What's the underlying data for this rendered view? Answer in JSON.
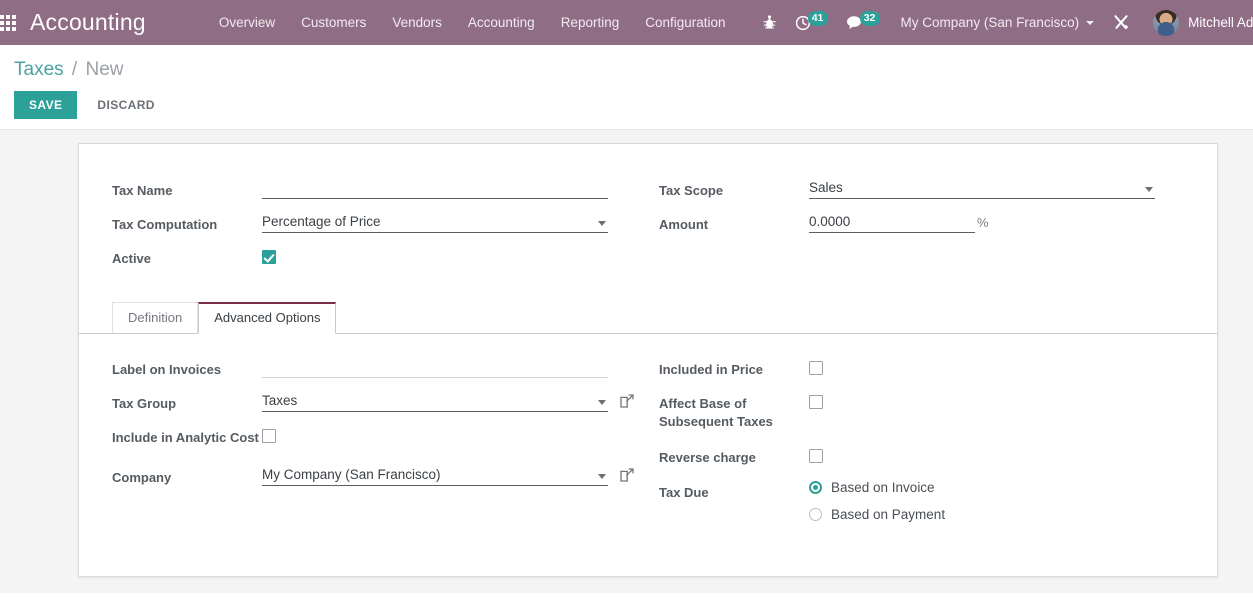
{
  "navbar": {
    "apps_icon": "apps-grid-icon",
    "brand": "Accounting",
    "menu": [
      {
        "label": "Overview"
      },
      {
        "label": "Customers"
      },
      {
        "label": "Vendors"
      },
      {
        "label": "Accounting"
      },
      {
        "label": "Reporting"
      },
      {
        "label": "Configuration"
      }
    ],
    "bug_icon": "bug-icon",
    "activities": {
      "icon": "clock-icon",
      "count": "41"
    },
    "messages": {
      "icon": "chat-bubble-icon",
      "count": "32"
    },
    "company": "My Company (San Francisco)",
    "tools_icon": "tools-icon",
    "avatar_icon": "user-avatar",
    "user": "Mitchell Admin (anton",
    "accent_badge": "#2ba199",
    "navbar_bg": "#8f6d85"
  },
  "control_panel": {
    "breadcrumb_root": "Taxes",
    "breadcrumb_sep": "/",
    "breadcrumb_current": "New",
    "save_label": "SAVE",
    "discard_label": "DISCARD",
    "save_color": "#2ba199"
  },
  "form": {
    "tax_name": {
      "label": "Tax Name",
      "value": "",
      "placeholder": ""
    },
    "tax_computation": {
      "label": "Tax Computation",
      "value": "Percentage of Price"
    },
    "active": {
      "label": "Active",
      "checked": true
    },
    "tax_scope": {
      "label": "Tax Scope",
      "value": "Sales"
    },
    "amount": {
      "label": "Amount",
      "value": "0.0000",
      "suffix": "%"
    }
  },
  "tabs": [
    {
      "label": "Definition",
      "active": false
    },
    {
      "label": "Advanced Options",
      "active": true
    }
  ],
  "advanced": {
    "label_on_invoices": {
      "label": "Label on Invoices",
      "value": "",
      "placeholder": ""
    },
    "tax_group": {
      "label": "Tax Group",
      "value": "Taxes",
      "external_link": "external-link-icon"
    },
    "include_analytic": {
      "label": "Include in Analytic Cost",
      "checked": false
    },
    "company": {
      "label": "Company",
      "value": "My Company (San Francisco)",
      "external_link": "external-link-icon"
    },
    "included_in_price": {
      "label": "Included in Price",
      "checked": false
    },
    "affect_base": {
      "label": "Affect Base of Subsequent Taxes",
      "checked": false
    },
    "reverse_charge": {
      "label": "Reverse charge",
      "checked": false
    },
    "tax_due": {
      "label": "Tax Due",
      "options": [
        {
          "label": "Based on Invoice",
          "selected": true
        },
        {
          "label": "Based on Payment",
          "selected": false
        }
      ]
    }
  }
}
